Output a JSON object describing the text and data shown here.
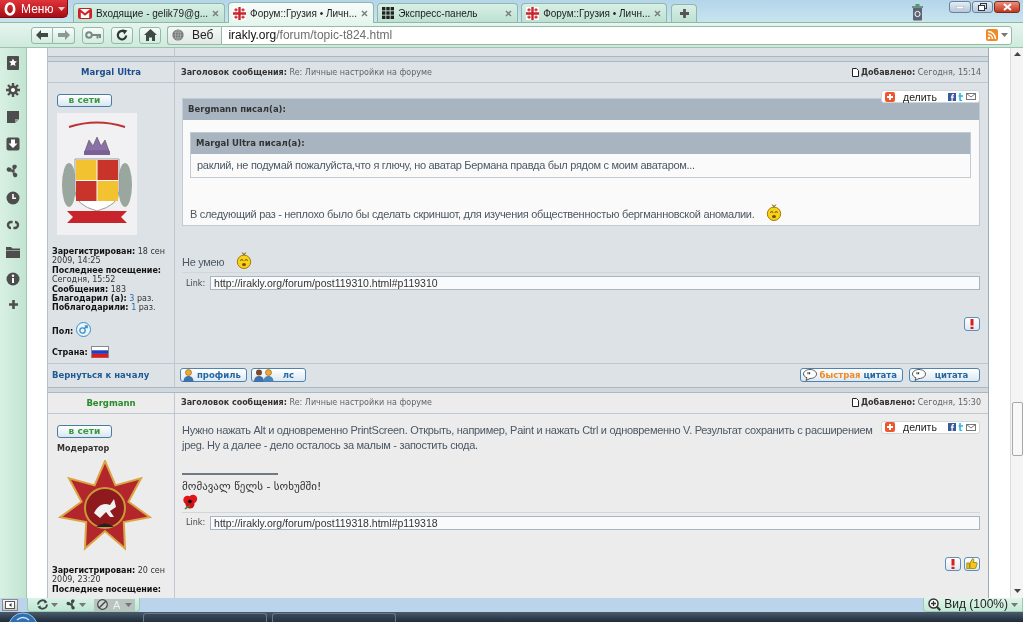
{
  "browser": {
    "menu": "Меню",
    "tabs": [
      {
        "kind": "mail",
        "title": "Входящие - gelik79@g...",
        "selected": false
      },
      {
        "kind": "forum",
        "title": "Форум::Грузия • Личн...",
        "selected": true
      },
      {
        "kind": "grid",
        "title": "Экспресс-панель",
        "selected": false
      },
      {
        "kind": "forum",
        "title": "Форум::Грузия • Личн...",
        "selected": false
      }
    ],
    "address": {
      "engine": "Веб",
      "host": "irakly.org",
      "path": "/forum/topic-t824.html"
    }
  },
  "posts": [
    {
      "author": {
        "name": "Margal Ultra",
        "color": "#1d4c8c"
      },
      "subject_label": "Заголовок сообщения:",
      "subject": "Re: Личные настройки на форуме",
      "posted_label": "Добавлено:",
      "posted": "Сегодня, 15:14",
      "status": "в сети",
      "profile": [
        {
          "label": "Зарегистрирован:",
          "value": "18 сен 2009, 14:25",
          "link": false
        },
        {
          "label": "Последнее посещение:",
          "value": "Сегодня, 15:52",
          "link": false
        },
        {
          "label": "Сообщения:",
          "value": "183",
          "link": false
        },
        {
          "label": "Благодарил (а):",
          "value": "3",
          "link": true,
          "suffix": "раз."
        },
        {
          "label": "Поблагодарили:",
          "value": "1",
          "link": true,
          "suffix": "раз."
        }
      ],
      "gender_label": "Пол:",
      "country_label": "Страна:",
      "share": "делить",
      "blocks": [
        {
          "kind": "quote",
          "author": "Bergmann писал(а):",
          "blocks": [
            {
              "kind": "quote",
              "author": "Margal Ultra писал(а):",
              "blocks": [
                {
                  "kind": "text",
                  "text": "раклий, не подумай пожалуйста,что я глючу, но аватар Бермана правда был рядом с моим аватаром...",
                  "emoticon": false
                }
              ]
            },
            {
              "kind": "text",
              "text": "В следующий раз - неплохо было бы сделать скриншот, для изучения общественностью бергманновской аномалии.",
              "emoticon": true
            }
          ]
        },
        {
          "kind": "text",
          "text": "Не умею",
          "emoticon": true
        }
      ],
      "link": {
        "label": "Link:",
        "value": "http://irakly.org/forum/post119310.html#p119310"
      },
      "actions": [
        {
          "kind": "report"
        }
      ],
      "footer": {
        "back_link": "Вернуться к началу",
        "buttons": [
          {
            "kind": "profile",
            "label": "профиль"
          },
          {
            "kind": "message",
            "label": "лс"
          },
          {
            "kind": "quick_quote",
            "accent": "быстрая",
            "label": "цитата"
          },
          {
            "kind": "quote",
            "label": "цитата"
          }
        ]
      }
    },
    {
      "author": {
        "name": "Bergmann",
        "color": "#2a8a2a"
      },
      "subject_label": "Заголовок сообщения:",
      "subject": "Re: Личные настройки на форуме",
      "posted_label": "Добавлено:",
      "posted": "Сегодня, 15:30",
      "status": "в сети",
      "rank": "Модератор",
      "profile": [
        {
          "label": "Зарегистрирован:",
          "value": "20 сен 2009, 23:20",
          "link": false
        },
        {
          "label": "Последнее посещение:",
          "link": false
        }
      ],
      "share": "делить",
      "blocks": [
        {
          "kind": "text",
          "text": "Нужно нажать Alt и одновременно PrintScreen. Открыть, например, Paint и нажать Ctrl и одновременно V. Результат сохранить с расширением jpeg. Ну а далее - дело осталось за малым - запостить сюда.",
          "emoticon": false
        },
        {
          "kind": "signature",
          "text": "მომავალ წელს - სოხუმში!",
          "emoticon": true
        }
      ],
      "link": {
        "label": "Link:",
        "value": "http://irakly.org/forum/post119318.html#p119318"
      },
      "actions": [
        {
          "kind": "report"
        },
        {
          "kind": "thanks"
        }
      ]
    }
  ],
  "status_bar": {
    "view_letter": "A",
    "zoom": "Вид (100%)"
  }
}
